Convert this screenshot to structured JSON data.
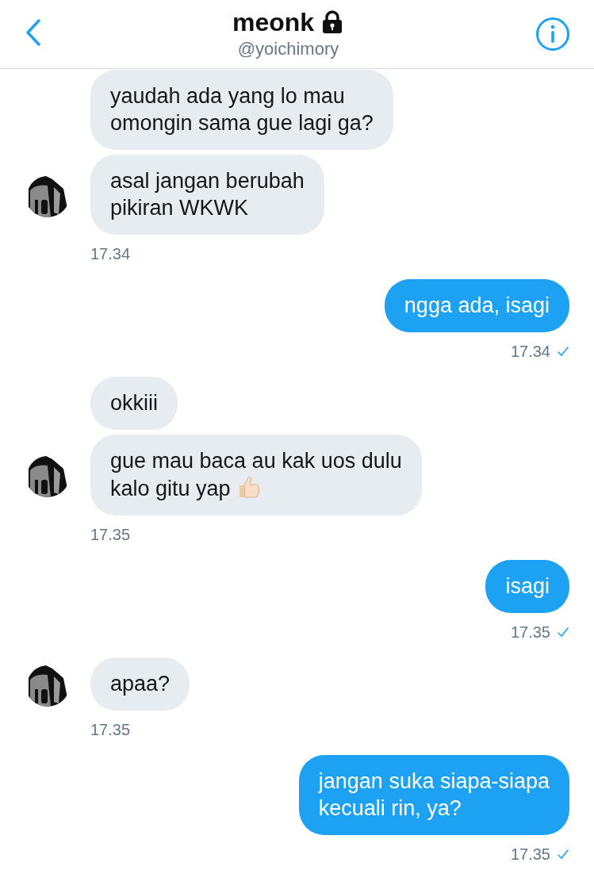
{
  "header": {
    "name": "meonk",
    "locked": true,
    "handle": "@yoichimory"
  },
  "groups": [
    {
      "kind": "incoming",
      "bubbles": [
        {
          "text": "yaudah ada yang lo mau\nomongin sama gue lagi ga?",
          "emoji": false
        },
        {
          "text": "asal jangan berubah\npikiran WKWK",
          "emoji": false
        }
      ],
      "time": "17.34",
      "seen": false
    },
    {
      "kind": "outgoing",
      "bubbles": [
        {
          "text": "ngga ada, isagi",
          "emoji": false
        }
      ],
      "time": "17.34",
      "seen": true
    },
    {
      "kind": "incoming",
      "bubbles": [
        {
          "text": "okkiii",
          "emoji": false
        },
        {
          "text": "gue mau baca au kak uos dulu\nkalo gitu yap",
          "emoji": true
        }
      ],
      "time": "17.35",
      "seen": false
    },
    {
      "kind": "outgoing",
      "bubbles": [
        {
          "text": "isagi",
          "emoji": false
        }
      ],
      "time": "17.35",
      "seen": true
    },
    {
      "kind": "incoming",
      "bubbles": [
        {
          "text": "apaa?",
          "emoji": false
        }
      ],
      "time": "17.35",
      "seen": false
    },
    {
      "kind": "outgoing",
      "bubbles": [
        {
          "text": "jangan suka siapa-siapa\nkecuali rin, ya?",
          "emoji": false
        }
      ],
      "time": "17.35",
      "seen": true
    }
  ]
}
